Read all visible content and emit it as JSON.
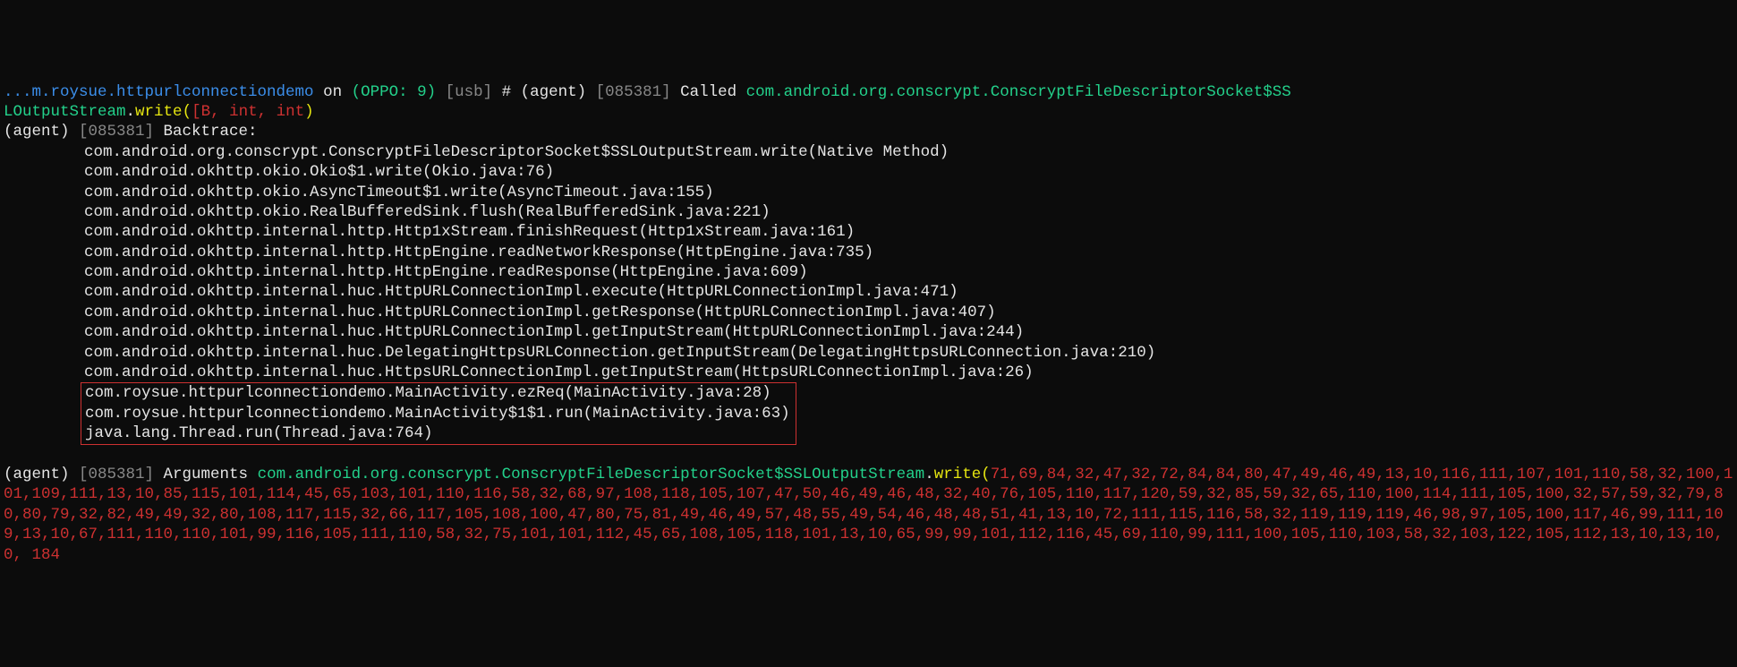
{
  "prompt": {
    "pkg": "...m.roysue.httpurlconnectiondemo",
    "on": " on ",
    "device": "(OPPO: 9)",
    "usb": " [usb]",
    "hash": " # "
  },
  "call": {
    "agent": "(agent) ",
    "pid": "[085381]",
    "called": " Called ",
    "class1": "com.android.org.conscrypt.ConscryptFileDescriptorSocket$SS",
    "class2": "LOutputStream",
    "dot": ".",
    "method": "write",
    "paren_open": "(",
    "args": "[B, int, int",
    "paren_close": ")"
  },
  "bt": {
    "agent": "(agent) ",
    "pid": "[085381]",
    "label": " Backtrace:",
    "lines": [
      "com.android.org.conscrypt.ConscryptFileDescriptorSocket$SSLOutputStream.write(Native Method)",
      "com.android.okhttp.okio.Okio$1.write(Okio.java:76)",
      "com.android.okhttp.okio.AsyncTimeout$1.write(AsyncTimeout.java:155)",
      "com.android.okhttp.okio.RealBufferedSink.flush(RealBufferedSink.java:221)",
      "com.android.okhttp.internal.http.Http1xStream.finishRequest(Http1xStream.java:161)",
      "com.android.okhttp.internal.http.HttpEngine.readNetworkResponse(HttpEngine.java:735)",
      "com.android.okhttp.internal.http.HttpEngine.readResponse(HttpEngine.java:609)",
      "com.android.okhttp.internal.huc.HttpURLConnectionImpl.execute(HttpURLConnectionImpl.java:471)",
      "com.android.okhttp.internal.huc.HttpURLConnectionImpl.getResponse(HttpURLConnectionImpl.java:407)",
      "com.android.okhttp.internal.huc.HttpURLConnectionImpl.getInputStream(HttpURLConnectionImpl.java:244)",
      "com.android.okhttp.internal.huc.DelegatingHttpsURLConnection.getInputStream(DelegatingHttpsURLConnection.java:210)",
      "com.android.okhttp.internal.huc.HttpsURLConnectionImpl.getInputStream(HttpsURLConnectionImpl.java:26)"
    ],
    "boxed": [
      "com.roysue.httpurlconnectiondemo.MainActivity.ezReq(MainActivity.java:28)",
      "com.roysue.httpurlconnectiondemo.MainActivity$1$1.run(MainActivity.java:63)",
      "java.lang.Thread.run(Thread.java:764)"
    ]
  },
  "args": {
    "agent": "(agent) ",
    "pid": "[085381]",
    "label": " Arguments ",
    "class": "com.android.org.conscrypt.ConscryptFileDescriptorSocket$SSLOutputStream",
    "dot": ".",
    "method": "write",
    "paren_open": "(",
    "bytes": "71,69,84,32,47,32,72,84,84,80,47,49,46,49,13,10,116,111,107,101,110,58,32,100,101,109,111,13,10,85,115,101,114,45,65,103,101,110,116,58,32,68,97,108,118,105,107,47,50,46,49,46,48,32,40,76,105,110,117,120,59,32,85,59,32,65,110,100,114,111,105,100,32,57,59,32,79,80,80,79,32,82,49,49,32,80,108,117,115,32,66,117,105,108,100,47,80,75,81,49,46,49,57,48,55,49,54,46,48,48,51,41,13,10,72,111,115,116,58,32,119,119,119,46,98,97,105,100,117,46,99,111,109,13,10,67,111,110,110,101,99,116,105,111,110,58,32,75,101,101,112,45,65,108,105,118,101,13,10,65,99,99,101,112,116,45,69,110,99,111,100,105,110,103,58,32,103,122,105,112,13,10,13,10, 0, 184",
    "cut": ",49,46,49,13,10,116,111,107,101,110,58,32,100,101,109,111,13,10,85,115,101,114,45,65,103,101,110,116,58,32,68,97,108,118,105,107,47,50,46,49,46,48,32,40,76,105,110,117,120,59,32,85,59,32,65,110,100,114,111,105,100,32,57,59,32,79,80,80,79,32,82,49,49,32,80,108,117,115,32,66,117,105,108,100,47,80,75,81,49,46,49,57,48,55,49,54,46,48,48,51,41,13,10,72,111,115,116,58,32,119,119,119,46,98,97,105,100,117,46,99,111,109,13,10,67,111,110,110,101,99,116,105,111,110,58,32,75,101,101,112,45,65,108,105,118,101,13,10,65,99,99,101,112,116,45,69,110,99,111,100,105,110,103,58,32,103,122,105,112,13,10,13,10, 0, 184"
  }
}
